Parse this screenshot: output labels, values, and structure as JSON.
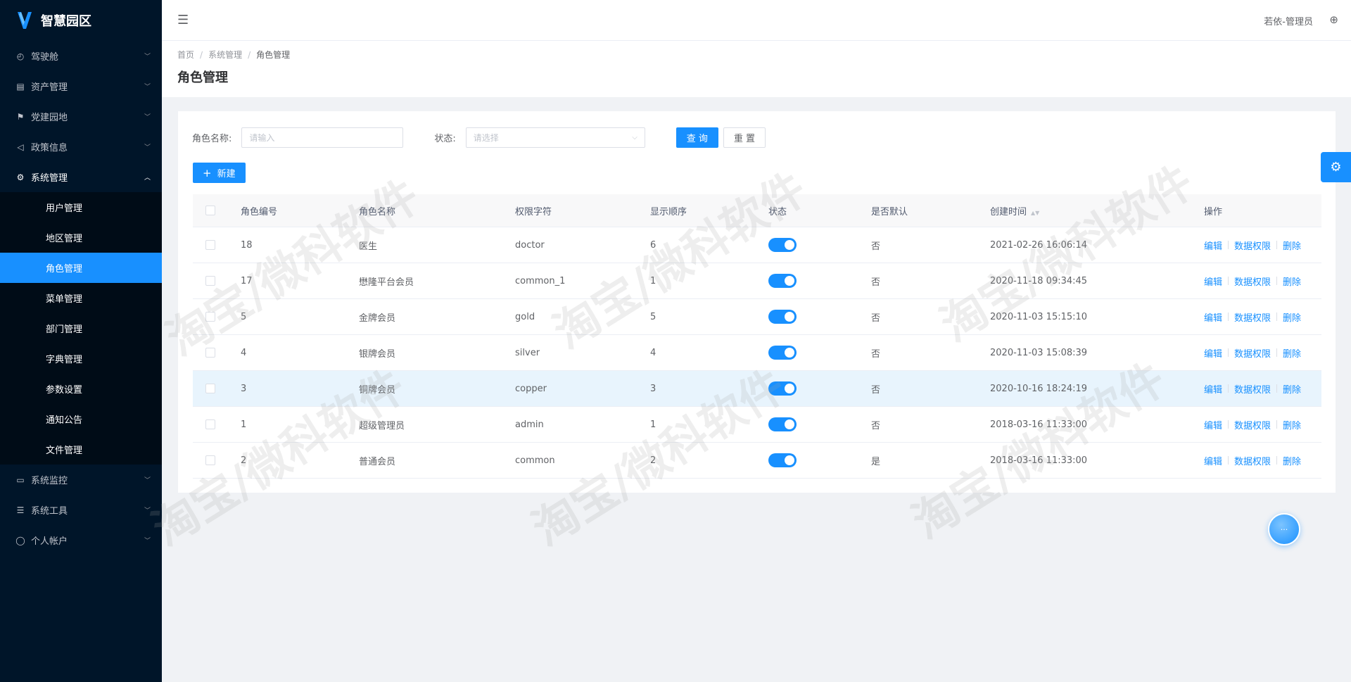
{
  "app": {
    "title": "智慧园区"
  },
  "sidebar": {
    "items": [
      {
        "label": "驾驶舱",
        "icon": "dashboard-icon"
      },
      {
        "label": "资产管理",
        "icon": "asset-icon"
      },
      {
        "label": "党建园地",
        "icon": "flag-icon"
      },
      {
        "label": "政策信息",
        "icon": "megaphone-icon"
      },
      {
        "label": "系统管理",
        "icon": "gear-icon",
        "open": true,
        "children": [
          "用户管理",
          "地区管理",
          "角色管理",
          "菜单管理",
          "部门管理",
          "字典管理",
          "参数设置",
          "通知公告",
          "文件管理"
        ]
      },
      {
        "label": "系统监控",
        "icon": "monitor-icon"
      },
      {
        "label": "系统工具",
        "icon": "list-icon"
      },
      {
        "label": "个人帐户",
        "icon": "user-icon"
      }
    ],
    "active_child": "角色管理"
  },
  "header": {
    "user": "若依-管理员"
  },
  "breadcrumb": [
    "首页",
    "系统管理",
    "角色管理"
  ],
  "page_title": "角色管理",
  "search": {
    "role_name_label": "角色名称:",
    "role_name_placeholder": "请输入",
    "status_label": "状态:",
    "status_placeholder": "请选择",
    "query_label": "查 询",
    "reset_label": "重 置"
  },
  "new_button_label": "新建",
  "table": {
    "columns": [
      "角色编号",
      "角色名称",
      "权限字符",
      "显示顺序",
      "状态",
      "是否默认",
      "创建时间",
      "操作"
    ],
    "rows": [
      {
        "id": "18",
        "name": "医生",
        "key": "doctor",
        "order": "6",
        "enabled": true,
        "default": "否",
        "created": "2021-02-26 16:06:14"
      },
      {
        "id": "17",
        "name": "懋隆平台会员",
        "key": "common_1",
        "order": "1",
        "enabled": true,
        "default": "否",
        "created": "2020-11-18 09:34:45"
      },
      {
        "id": "5",
        "name": "金牌会员",
        "key": "gold",
        "order": "5",
        "enabled": true,
        "default": "否",
        "created": "2020-11-03 15:15:10"
      },
      {
        "id": "4",
        "name": "银牌会员",
        "key": "silver",
        "order": "4",
        "enabled": true,
        "default": "否",
        "created": "2020-11-03 15:08:39"
      },
      {
        "id": "3",
        "name": "铜牌会员",
        "key": "copper",
        "order": "3",
        "enabled": true,
        "default": "否",
        "created": "2020-10-16 18:24:19"
      },
      {
        "id": "1",
        "name": "超级管理员",
        "key": "admin",
        "order": "1",
        "enabled": true,
        "default": "否",
        "created": "2018-03-16 11:33:00"
      },
      {
        "id": "2",
        "name": "普通会员",
        "key": "common",
        "order": "2",
        "enabled": true,
        "default": "是",
        "created": "2018-03-16 11:33:00"
      }
    ],
    "actions": [
      "编辑",
      "数据权限",
      "删除"
    ]
  },
  "watermark_text": "淘宝/微科软件",
  "colors": {
    "primary": "#1890ff",
    "sidebar_bg": "#001529"
  }
}
